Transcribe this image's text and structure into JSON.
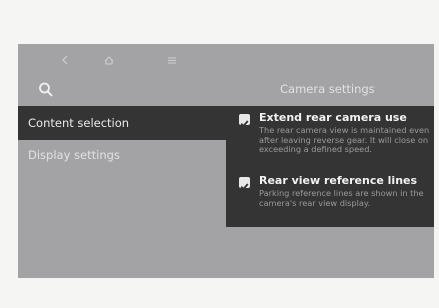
{
  "nav": {
    "back_icon": "back-chevron-icon",
    "home_icon": "home-icon",
    "menu_icon": "menu-icon"
  },
  "search": {
    "icon": "search-icon"
  },
  "header": {
    "title": "Camera settings"
  },
  "menu": {
    "items": [
      {
        "label": "Content selection",
        "active": true
      },
      {
        "label": "Display settings",
        "active": false
      }
    ]
  },
  "options": [
    {
      "label": "Extend rear camera use",
      "checked": true,
      "description": "The rear camera view is maintained even after leaving reverse gear. It will close on exceeding a defined speed."
    },
    {
      "label": "Rear view reference lines",
      "checked": true,
      "description": "Parking reference lines are shown in the camera's rear view display."
    }
  ],
  "colors": {
    "background": "#f5f5f4",
    "screen": "#a3a3a5",
    "panel": "#343434",
    "text_light": "#f2f2f2",
    "text_muted": "#9a9a9a"
  }
}
